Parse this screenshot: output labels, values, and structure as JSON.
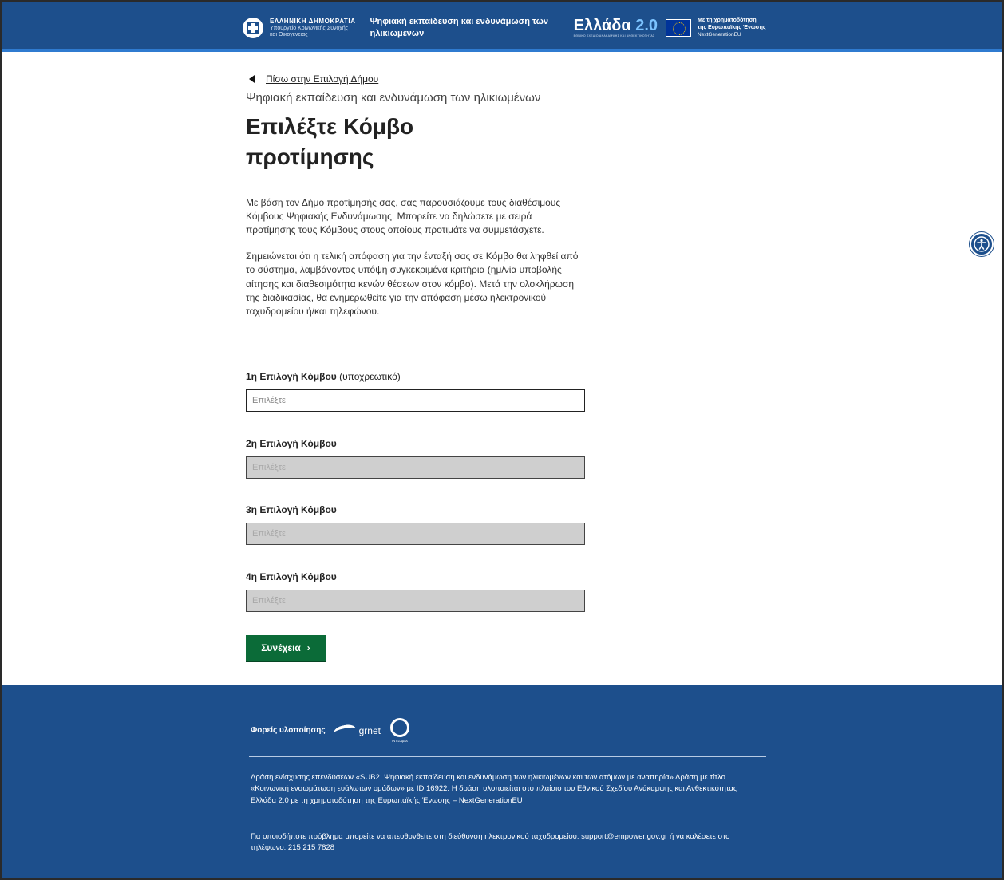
{
  "header": {
    "gov_title": "ΕΛΛΗΝΙΚΗ ΔΗΜΟΚΡΑΤΙΑ",
    "ministry_line1": "Υπουργείο Κοινωνικής Συνοχής",
    "ministry_line2": "και Οικογένειας",
    "program_title": "Ψηφιακή εκπαίδευση και ενδυνάμωση των ηλικιωμένων",
    "greece_logo_text": "Ελλάδα",
    "greece_logo_version": "2.0",
    "greece_logo_sub": "ΕΘΝΙΚΟ ΣΧΕΔΙΟ ΑΝΑΚΑΜΨΗΣ ΚΑΙ ΑΝΘΕΚΤΙΚΟΤΗΤΑΣ",
    "eu_line1": "Με τη χρηματοδότηση",
    "eu_line2": "της Ευρωπαϊκής Ένωσης",
    "eu_line3": "NextGenerationEU"
  },
  "main": {
    "back_link": "Πίσω στην Επιλογή Δήμου",
    "caption": "Ψηφιακή εκπαίδευση και ενδυνάμωση των ηλικιωμένων",
    "title": "Επιλέξτε Κόμβο προτίμησης",
    "paragraph1": "Με βάση τον Δήμο προτίμησής σας, σας παρουσιάζουμε τους διαθέσιμους Κόμβους Ψηφιακής Ενδυνάμωσης. Μπορείτε να δηλώσετε με σειρά προτίμησης τους Κόμβους στους οποίους προτιμάτε να συμμετάσχετε.",
    "paragraph2": "Σημειώνεται ότι η τελική απόφαση για την ένταξή σας σε Κόμβο θα ληφθεί από το σύστημα, λαμβάνοντας υπόψη συγκεκριμένα κριτήρια (ημ/νία υποβολής αίτησης και διαθεσιμότητα κενών θέσεων στον κόμβο). Μετά την ολοκλήρωση της διαδικασίας, θα ενημερωθείτε για την απόφαση μέσω ηλεκτρονικού ταχυδρομείου ή/και τηλεφώνου.",
    "fields": [
      {
        "label": "1η Επιλογή Κόμβου",
        "note": "(υποχρεωτικό)",
        "placeholder": "Επιλέξτε",
        "disabled": false
      },
      {
        "label": "2η Επιλογή Κόμβου",
        "note": "",
        "placeholder": "Επιλέξτε",
        "disabled": true
      },
      {
        "label": "3η Επιλογή Κόμβου",
        "note": "",
        "placeholder": "Επιλέξτε",
        "disabled": true
      },
      {
        "label": "4η Επιλογή Κόμβου",
        "note": "",
        "placeholder": "Επιλέξτε",
        "disabled": true
      }
    ],
    "submit_label": "Συνέχεια",
    "submit_chevron": "›"
  },
  "footer": {
    "impl_label": "Φορείς υλοποίησης",
    "grnet_text": "grnet",
    "eesa_text": "ΙΝ ΕΣΑμεΑ",
    "text1": "Δράση ενίσχυσης επενδύσεων «SUB2. Ψηφιακή εκπαίδευση και ενδυνάμωση των ηλικιωμένων και των ατόμων με αναπηρία» Δράση με τίτλο «Κοινωνική ενσωμάτωση ευάλωτων ομάδων» με ID 16922. Η δράση υλοποιείται στο πλαίσιο του Εθνικού Σχεδίου Ανάκαμψης και Ανθεκτικότητας Ελλάδα 2.0 με τη χρηματοδότηση της Ευρωπαϊκής Ένωσης – NextGenerationEU",
    "text2": "Για οποιοδήποτε πρόβλημα μπορείτε να απευθυνθείτε στη διεύθυνση ηλεκτρονικού ταχυδρομείου: support@empower.gov.gr ή να καλέσετε στο τηλέφωνο: 215 215 7828"
  },
  "colors": {
    "header_bg": "#1d4f8c",
    "button_green": "#0b6b38",
    "disabled_field": "#cfcfcf"
  }
}
